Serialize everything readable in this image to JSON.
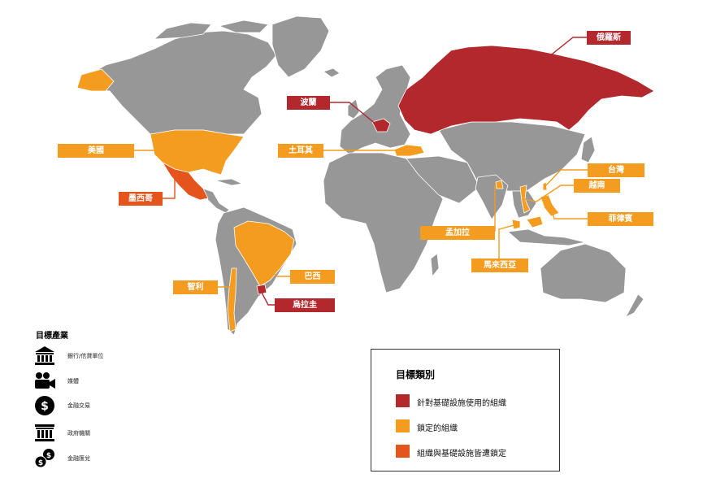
{
  "colors": {
    "land": "#979797",
    "border": "#ffffff",
    "infrastructure": "#b3282d",
    "targeted": "#f39c1f",
    "both": "#e6541e"
  },
  "countries": [
    {
      "id": "russia",
      "label": "俄羅斯",
      "category": "infrastructure"
    },
    {
      "id": "poland",
      "label": "波蘭",
      "category": "infrastructure"
    },
    {
      "id": "usa",
      "label": "美國",
      "category": "targeted"
    },
    {
      "id": "turkey",
      "label": "土耳其",
      "category": "targeted"
    },
    {
      "id": "taiwan",
      "label": "台灣",
      "category": "targeted"
    },
    {
      "id": "vietnam",
      "label": "越南",
      "category": "targeted"
    },
    {
      "id": "mexico",
      "label": "墨西哥",
      "category": "both"
    },
    {
      "id": "philippines",
      "label": "菲律賓",
      "category": "targeted"
    },
    {
      "id": "bangladesh",
      "label": "孟加拉",
      "category": "targeted"
    },
    {
      "id": "malaysia",
      "label": "馬來西亞",
      "category": "targeted"
    },
    {
      "id": "brazil",
      "label": "巴西",
      "category": "targeted"
    },
    {
      "id": "chile",
      "label": "智利",
      "category": "targeted"
    },
    {
      "id": "uruguay",
      "label": "烏拉圭",
      "category": "infrastructure"
    }
  ],
  "industries": {
    "title": "目標產業",
    "items": [
      {
        "icon": "bank-icon",
        "label": "銀行/信貸單位"
      },
      {
        "icon": "video-camera-icon",
        "label": "媒體"
      },
      {
        "icon": "dollar-coin-icon",
        "label": "金融交易"
      },
      {
        "icon": "government-building-icon",
        "label": "政府機關"
      },
      {
        "icon": "coins-icon",
        "label": "金融匯兌"
      }
    ]
  },
  "legend": {
    "title": "目標類別",
    "items": [
      {
        "category": "infrastructure",
        "label": "針對基礎設施使用的組織"
      },
      {
        "category": "targeted",
        "label": "鎖定的組織"
      },
      {
        "category": "both",
        "label": "組織與基礎設施皆遭鎖定"
      }
    ]
  }
}
